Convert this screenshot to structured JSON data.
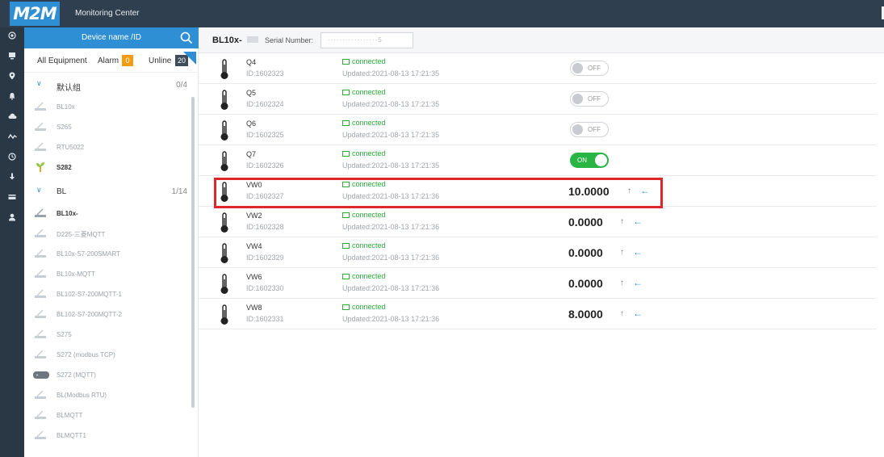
{
  "app": {
    "logo": "M2M",
    "title": "Monitoring Center"
  },
  "rail": {
    "icons": [
      "dashboard-icon",
      "monitor-icon",
      "location-icon",
      "alarm-icon",
      "cloud-icon",
      "trend-icon",
      "history-icon",
      "download-icon",
      "card-icon",
      "user-icon"
    ]
  },
  "panel": {
    "search_placeholder": "Device name /ID",
    "filters": {
      "all": "All Equipment",
      "alarm_label": "Alarm",
      "alarm_count": "0",
      "online_label": "Unline",
      "online_count": "20"
    },
    "group1": {
      "name": "默认组",
      "count": "0/4"
    },
    "group1_items": [
      {
        "name": "BL10x"
      },
      {
        "name": "S265"
      },
      {
        "name": "RTU5022"
      },
      {
        "name": "S282"
      }
    ],
    "group2": {
      "name": "BL",
      "count": "1/14"
    },
    "group2_items": [
      {
        "name": "BL10x-"
      },
      {
        "name": "D225-三菱MQTT"
      },
      {
        "name": "BL10x-S7-200SMART"
      },
      {
        "name": "BL10x-MQTT"
      },
      {
        "name": "BL102-S7-200MQTT-1"
      },
      {
        "name": "BL102-S7-200MQTT-2"
      },
      {
        "name": "S275"
      },
      {
        "name": "S272 (modbus TCP)"
      },
      {
        "name": "S272 (MQTT)"
      },
      {
        "name": "BL(Modbus RTU)"
      },
      {
        "name": "BLMQTT"
      },
      {
        "name": "BLMQTT1"
      }
    ]
  },
  "header": {
    "device": "BL10x-",
    "serial_label": "Serial Number:",
    "serial_value": "·················5"
  },
  "rows": [
    {
      "name": "Q4",
      "id": "ID:1602323",
      "status": "connected",
      "updated": "Updated:2021-08-13 17:21:35",
      "toggle": "OFF"
    },
    {
      "name": "Q5",
      "id": "ID:1602324",
      "status": "connected",
      "updated": "Updated:2021-08-13 17:21:35",
      "toggle": "OFF"
    },
    {
      "name": "Q6",
      "id": "ID:1602325",
      "status": "connected",
      "updated": "Updated:2021-08-13 17:21:35",
      "toggle": "OFF"
    },
    {
      "name": "Q7",
      "id": "ID:1602326",
      "status": "connected",
      "updated": "Updated:2021-08-13 17:21:35",
      "toggle": "ON"
    },
    {
      "name": "VW0",
      "id": "ID:1602327",
      "status": "connected",
      "updated": "Updated:2021-08-13 17:21:36",
      "value": "10.0000"
    },
    {
      "name": "VW2",
      "id": "ID:1602328",
      "status": "connected",
      "updated": "Updated:2021-08-13 17:21:36",
      "value": "0.0000"
    },
    {
      "name": "VW4",
      "id": "ID:1602329",
      "status": "connected",
      "updated": "Updated:2021-08-13 17:21:36",
      "value": "0.0000"
    },
    {
      "name": "VW6",
      "id": "ID:1602330",
      "status": "connected",
      "updated": "Updated:2021-08-13 17:21:36",
      "value": "0.0000"
    },
    {
      "name": "VW8",
      "id": "ID:1602331",
      "status": "connected",
      "updated": "Updated:2021-08-13 17:21:36",
      "value": "8.0000"
    }
  ],
  "actions": {
    "up_glyph": "↑",
    "write_glyph": "←"
  },
  "colors": {
    "topbar": "#2f3f4f",
    "rail": "#2a3846",
    "accent": "#2f8fd4",
    "connected": "#2aab3a",
    "alarm_badge": "#f39c12",
    "online_badge": "#3d4b5a",
    "highlight": "#e0262d",
    "toggle_on": "#29b543"
  }
}
